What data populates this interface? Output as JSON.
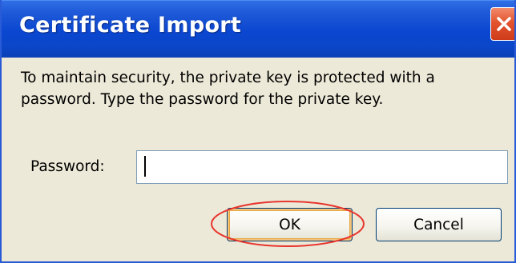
{
  "dialog": {
    "title": "Certificate Import",
    "message": "To maintain security, the private key is protected with a password. Type the password for the private key.",
    "password_label": "Password:",
    "password_value": "",
    "ok_label": "OK",
    "cancel_label": "Cancel"
  },
  "colors": {
    "titlebar": "#0a46d0",
    "body": "#ece9d8",
    "close_button": "#e2542e",
    "highlight_ring": "#e8352d"
  },
  "icons": {
    "close": "close-icon"
  }
}
